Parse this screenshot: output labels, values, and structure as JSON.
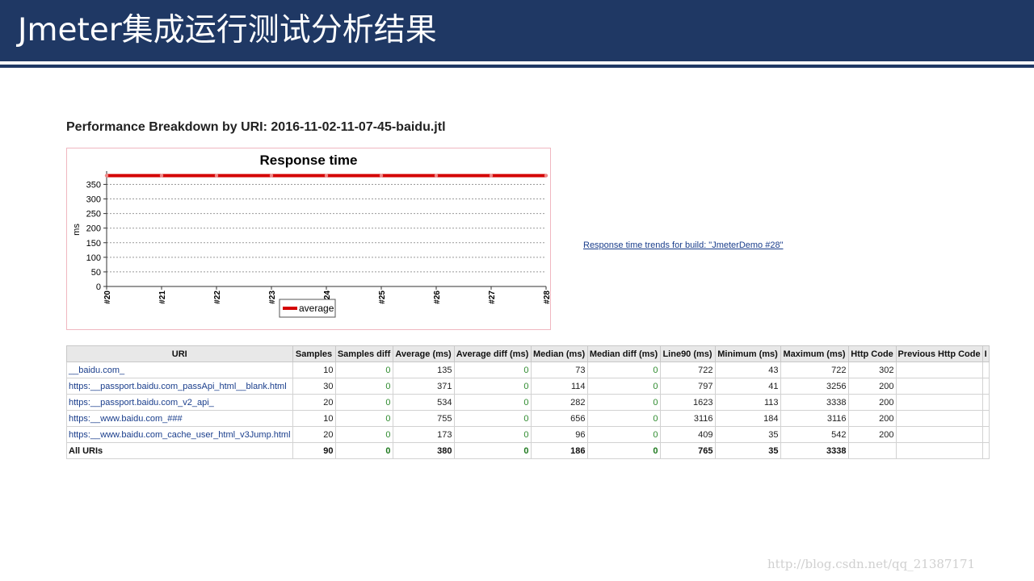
{
  "slide": {
    "title": "Jmeter集成运行测试分析结果",
    "section_title": "Performance Breakdown by URI: 2016-11-02-11-07-45-baidu.jtl",
    "trend_link": " Response time trends for build: \"JmeterDemo #28\"",
    "watermark": "http://blog.csdn.net/qq_21387171",
    "header_color": "#1f3864"
  },
  "chart_data": {
    "type": "line",
    "title": "Response time",
    "ylabel": "ms",
    "xlabel": "",
    "x": [
      "#20",
      "#21",
      "#22",
      "#23",
      "#24",
      "#25",
      "#26",
      "#27",
      "#28"
    ],
    "y_ticks": [
      0,
      50,
      100,
      150,
      200,
      250,
      300,
      350
    ],
    "ylim": [
      0,
      390
    ],
    "grid": true,
    "legend_position": "bottom",
    "series": [
      {
        "name": "average",
        "color": "#d40000",
        "values": [
          380,
          380,
          380,
          380,
          380,
          380,
          380,
          380,
          380
        ]
      }
    ]
  },
  "table": {
    "headers": [
      "URI",
      "Samples",
      "Samples diff",
      "Average (ms)",
      "Average diff (ms)",
      "Median (ms)",
      "Median diff (ms)",
      "Line90 (ms)",
      "Minimum (ms)",
      "Maximum (ms)",
      "Http Code",
      "Previous Http Code",
      "I"
    ],
    "rows": [
      [
        "__baidu.com_",
        "10",
        "0",
        "135",
        "0",
        "73",
        "0",
        "722",
        "43",
        "722",
        "302",
        "",
        ""
      ],
      [
        "https:__passport.baidu.com_passApi_html__blank.html",
        "30",
        "0",
        "371",
        "0",
        "114",
        "0",
        "797",
        "41",
        "3256",
        "200",
        "",
        ""
      ],
      [
        "https:__passport.baidu.com_v2_api_",
        "20",
        "0",
        "534",
        "0",
        "282",
        "0",
        "1623",
        "113",
        "3338",
        "200",
        "",
        ""
      ],
      [
        "https:__www.baidu.com_###",
        "10",
        "0",
        "755",
        "0",
        "656",
        "0",
        "3116",
        "184",
        "3116",
        "200",
        "",
        ""
      ],
      [
        "https:__www.baidu.com_cache_user_html_v3Jump.html",
        "20",
        "0",
        "173",
        "0",
        "96",
        "0",
        "409",
        "35",
        "542",
        "200",
        "",
        ""
      ]
    ],
    "total": [
      "All URIs",
      "90",
      "0",
      "380",
      "0",
      "186",
      "0",
      "765",
      "35",
      "3338",
      "",
      "",
      ""
    ]
  }
}
